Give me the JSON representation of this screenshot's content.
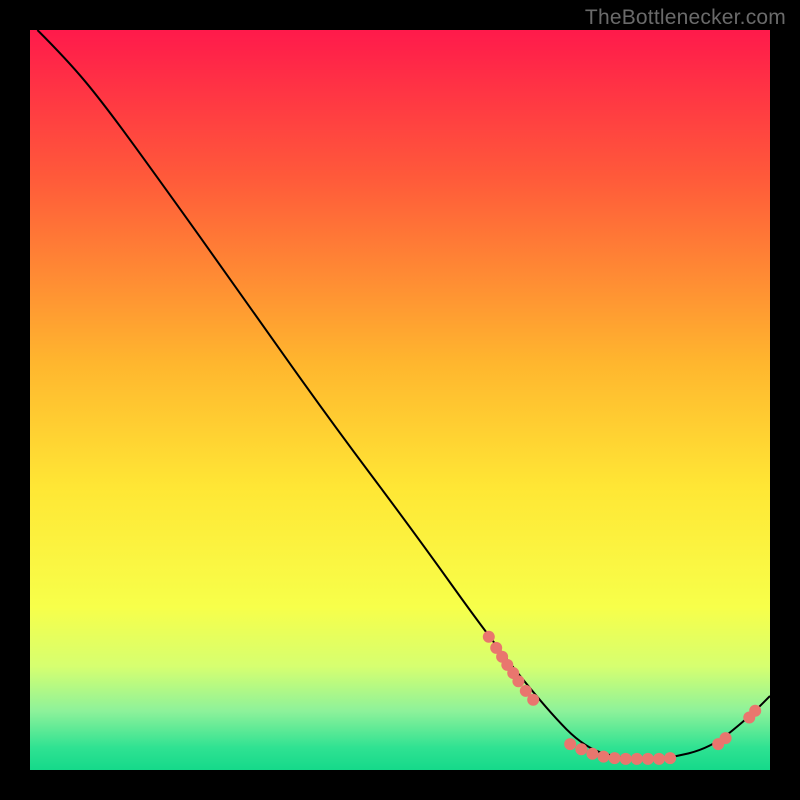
{
  "watermark": "TheBottlenecker.com",
  "chart_data": {
    "type": "line",
    "xlim": [
      0,
      100
    ],
    "ylim": [
      0,
      100
    ],
    "gradient_stops": [
      {
        "offset": 0,
        "color": "#ff1a4b"
      },
      {
        "offset": 20,
        "color": "#ff5a3a"
      },
      {
        "offset": 45,
        "color": "#ffb62e"
      },
      {
        "offset": 62,
        "color": "#ffe735"
      },
      {
        "offset": 78,
        "color": "#f7ff4a"
      },
      {
        "offset": 86,
        "color": "#d6ff70"
      },
      {
        "offset": 92,
        "color": "#8ef29a"
      },
      {
        "offset": 97,
        "color": "#2fe292"
      },
      {
        "offset": 100,
        "color": "#15d98a"
      }
    ],
    "curve": [
      {
        "x": 1,
        "y": 100
      },
      {
        "x": 5,
        "y": 96
      },
      {
        "x": 10,
        "y": 90
      },
      {
        "x": 18,
        "y": 79
      },
      {
        "x": 28,
        "y": 65
      },
      {
        "x": 40,
        "y": 48
      },
      {
        "x": 52,
        "y": 32
      },
      {
        "x": 62,
        "y": 18
      },
      {
        "x": 70,
        "y": 8
      },
      {
        "x": 75,
        "y": 3
      },
      {
        "x": 80,
        "y": 1.5
      },
      {
        "x": 86,
        "y": 1.5
      },
      {
        "x": 92,
        "y": 3
      },
      {
        "x": 97,
        "y": 7
      },
      {
        "x": 100,
        "y": 10
      }
    ],
    "markers_left_cluster": [
      {
        "x": 62,
        "y": 18
      },
      {
        "x": 63,
        "y": 16.5
      },
      {
        "x": 63.8,
        "y": 15.3
      },
      {
        "x": 64.5,
        "y": 14.2
      },
      {
        "x": 65.3,
        "y": 13.1
      },
      {
        "x": 66,
        "y": 12
      },
      {
        "x": 67,
        "y": 10.7
      },
      {
        "x": 68,
        "y": 9.5
      }
    ],
    "markers_bottom_cluster": [
      {
        "x": 73,
        "y": 3.5
      },
      {
        "x": 74.5,
        "y": 2.8
      },
      {
        "x": 76,
        "y": 2.2
      },
      {
        "x": 77.5,
        "y": 1.8
      },
      {
        "x": 79,
        "y": 1.6
      },
      {
        "x": 80.5,
        "y": 1.5
      },
      {
        "x": 82,
        "y": 1.5
      },
      {
        "x": 83.5,
        "y": 1.5
      },
      {
        "x": 85,
        "y": 1.5
      },
      {
        "x": 86.5,
        "y": 1.6
      }
    ],
    "markers_right_cluster": [
      {
        "x": 93,
        "y": 3.5
      },
      {
        "x": 94,
        "y": 4.3
      },
      {
        "x": 97.2,
        "y": 7.1
      },
      {
        "x": 98,
        "y": 8
      }
    ],
    "marker_color": "#e9766e",
    "line_color": "#000000"
  }
}
